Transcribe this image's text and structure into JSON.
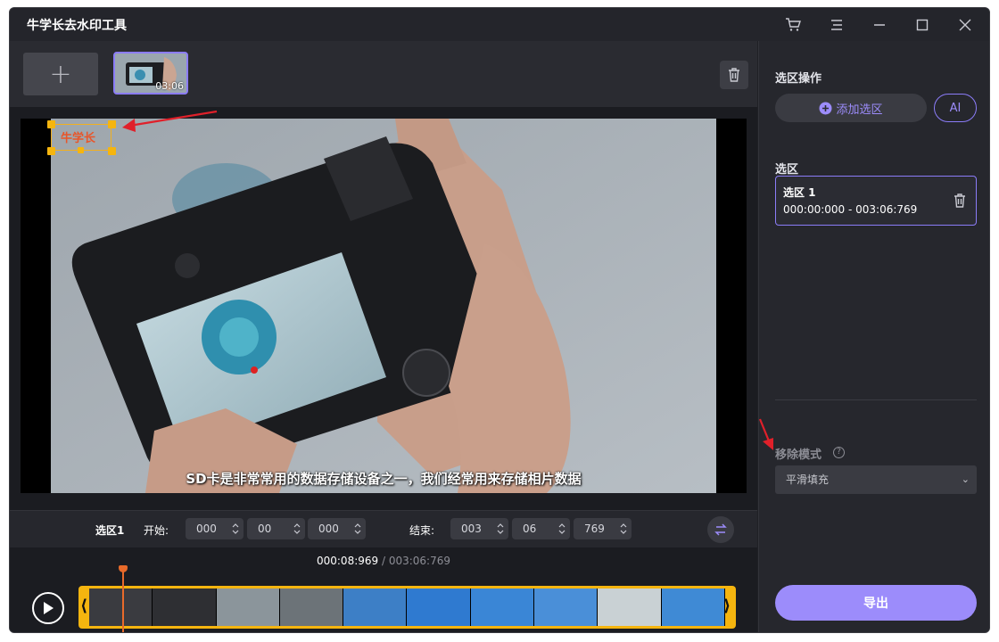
{
  "app": {
    "title": "牛学长去水印工具",
    "controls": [
      "cart-icon",
      "menu-icon",
      "minimize-icon",
      "maximize-icon",
      "close-icon"
    ]
  },
  "media": {
    "add_label": "+",
    "thumbnail_duration": "03:06"
  },
  "video": {
    "subtitle": "SD卡是非常常用的数据存储设备之一，我们经常用来存储相片数据",
    "watermark_text": "牛学长"
  },
  "range": {
    "selection_label": "选区1",
    "start_label": "开始:",
    "start": [
      "000",
      "00",
      "000"
    ],
    "end_label": "结束:",
    "end": [
      "003",
      "06",
      "769"
    ]
  },
  "timeline": {
    "current": "000:08:969",
    "separator": " / ",
    "total": "003:06:769"
  },
  "sidebar": {
    "ops_title": "选区操作",
    "add_selection_label": "添加选区",
    "ai_label": "AI",
    "selections_title": "选区",
    "selection": {
      "name": "选区 1",
      "range": "000:00:000 - 003:06:769"
    },
    "removal_mode_label": "移除模式",
    "removal_mode_value": "平滑填充",
    "export_label": "导出"
  },
  "colors": {
    "accent": "#9c8cfb",
    "handle": "#f5b50f",
    "arrow": "#e0202a"
  }
}
